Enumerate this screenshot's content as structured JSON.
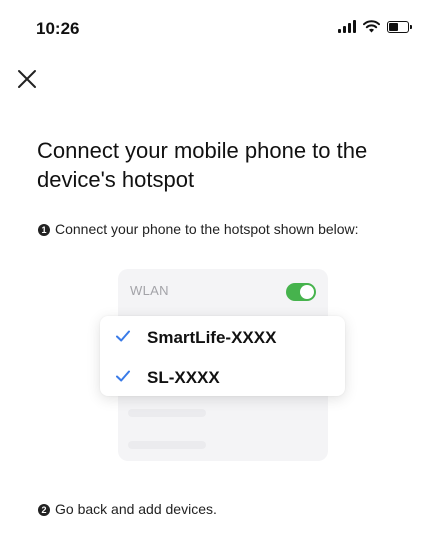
{
  "status_bar": {
    "time": "10:26",
    "icons": [
      "signal-icon",
      "wifi-icon",
      "battery-icon"
    ]
  },
  "header": {
    "close_icon": "close-icon"
  },
  "title": "Connect your mobile phone to the device's hotspot",
  "steps": [
    {
      "number": "1",
      "text": "Connect your phone to the hotspot shown below:"
    },
    {
      "number": "2",
      "text": "Go back and add devices."
    }
  ],
  "illustration": {
    "wlan_label": "WLAN",
    "wlan_enabled": true,
    "networks": [
      {
        "name": "SmartLife-XXXX",
        "checked": true
      },
      {
        "name": "SL-XXXX",
        "checked": true
      }
    ]
  },
  "colors": {
    "toggle_on": "#46b34d",
    "check": "#3a7be8",
    "text": "#111111",
    "muted": "#a3a3a8"
  }
}
